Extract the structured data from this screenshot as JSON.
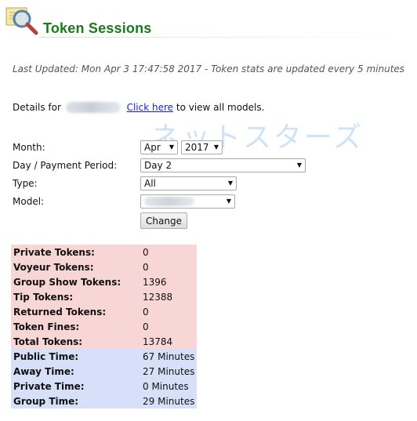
{
  "header": {
    "title": "Token Sessions",
    "icon": "magnifier-icon"
  },
  "last_updated": "Last Updated: Mon Apr 3 17:47:58 2017 - Token stats are updated every 5 minutes",
  "details": {
    "prefix": "Details for",
    "link_text": "Click here",
    "suffix": "to view all models."
  },
  "watermark": "ネットスターズ",
  "form": {
    "month": {
      "label": "Month:",
      "month_value": "Apr",
      "year_value": "2017"
    },
    "period": {
      "label": "Day / Payment Period:",
      "value": "Day 2"
    },
    "type": {
      "label": "Type:",
      "value": "All"
    },
    "model": {
      "label": "Model:"
    },
    "change_button": "Change"
  },
  "token_stats": [
    {
      "label": "Private Tokens:",
      "value": "0"
    },
    {
      "label": "Voyeur Tokens:",
      "value": "0"
    },
    {
      "label": "Group Show Tokens:",
      "value": "1396"
    },
    {
      "label": "Tip Tokens:",
      "value": "12388"
    },
    {
      "label": "Returned Tokens:",
      "value": "0"
    },
    {
      "label": "Token Fines:",
      "value": "0"
    },
    {
      "label": "Total Tokens:",
      "value": "13784"
    }
  ],
  "time_stats": [
    {
      "label": "Public Time:",
      "value": "67 Minutes"
    },
    {
      "label": "Away Time:",
      "value": "27 Minutes"
    },
    {
      "label": "Private Time:",
      "value": "0 Minutes"
    },
    {
      "label": "Group Time:",
      "value": "29 Minutes"
    }
  ],
  "colors": {
    "title": "#1a7a1a",
    "token_bg": "#f9d6d6",
    "time_bg": "#d6e0f9",
    "link": "#1a1aee"
  }
}
